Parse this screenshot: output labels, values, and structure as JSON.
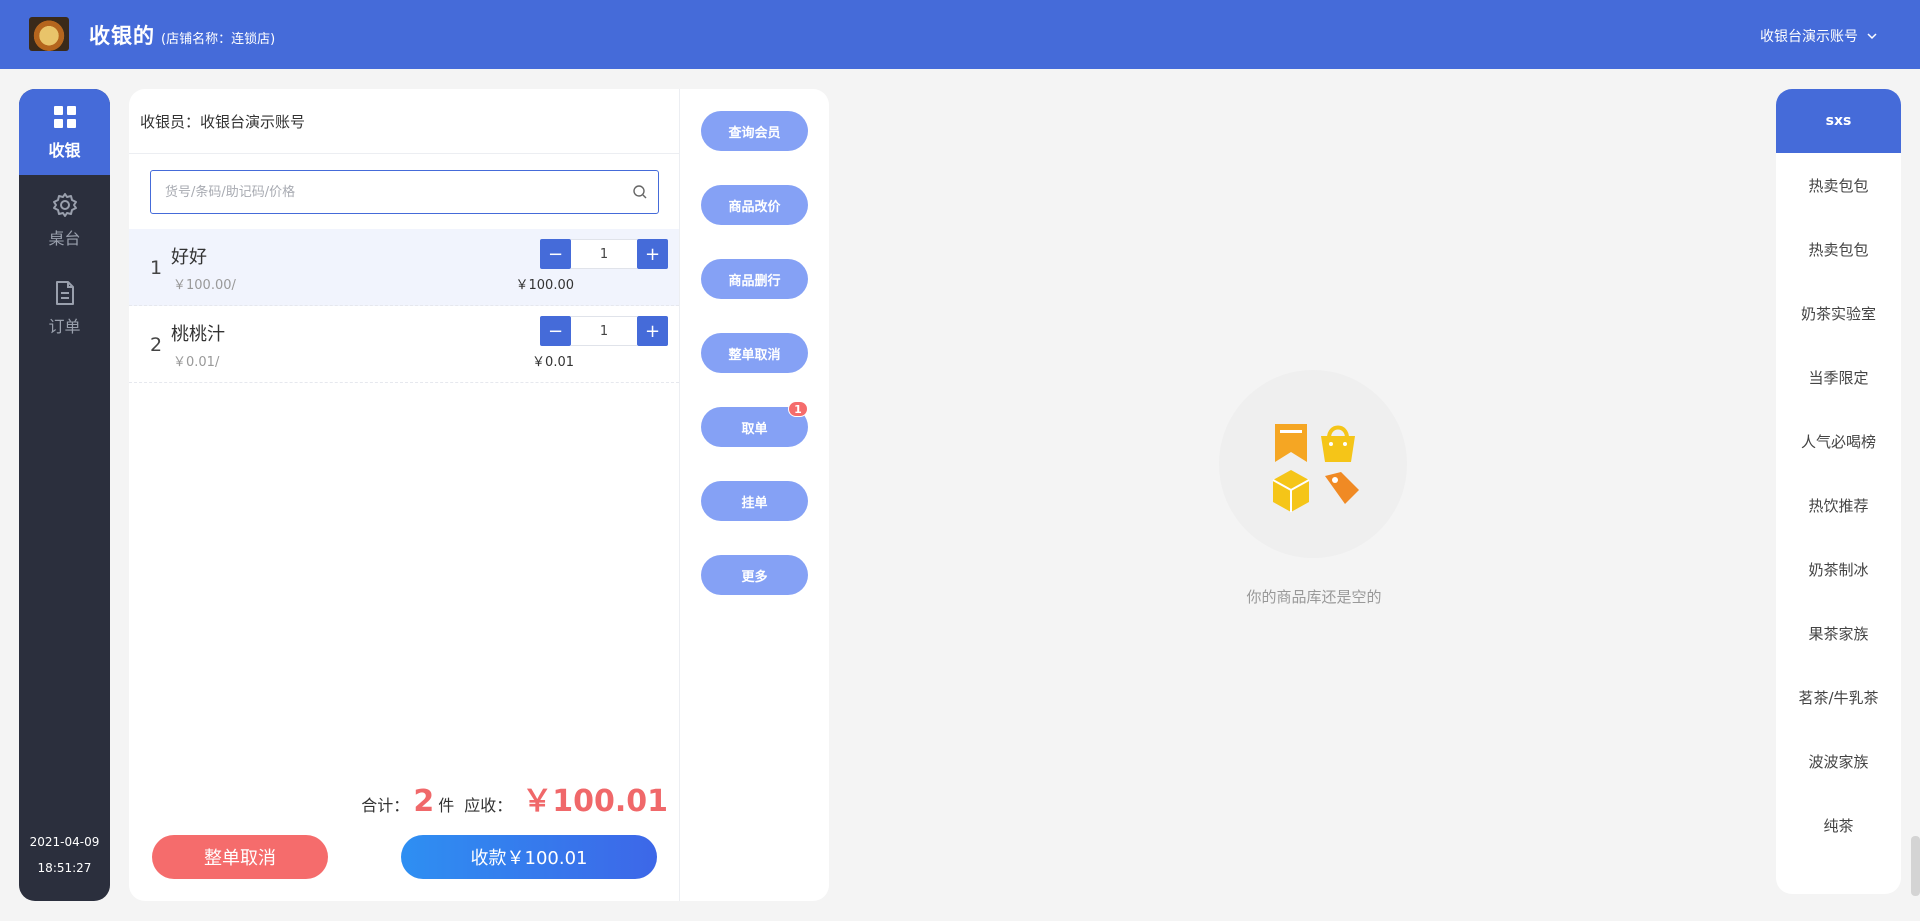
{
  "header": {
    "title": "收银的",
    "store_name": "(店铺名称：连锁店)",
    "account": "收银台演示账号"
  },
  "nav": {
    "items": [
      {
        "label": "收银",
        "icon": "grid-icon",
        "active": true
      },
      {
        "label": "桌台",
        "icon": "gear-icon",
        "active": false
      },
      {
        "label": "订单",
        "icon": "document-icon",
        "active": false
      }
    ],
    "date": "2021-04-09",
    "time": "18:51:27"
  },
  "order": {
    "cashier_line": "收银员：收银台演示账号",
    "search_placeholder": "货号/条码/助记码/价格",
    "items": [
      {
        "index": "1",
        "name": "好好",
        "unit_price": "￥100.00/",
        "quantity": "1",
        "subtotal": "￥100.00"
      },
      {
        "index": "2",
        "name": "桃桃汁",
        "unit_price": "￥0.01/",
        "quantity": "1",
        "subtotal": "￥0.01"
      }
    ],
    "total_label": "合计：",
    "total_count": "2",
    "count_unit": "件",
    "due_label": "应收：",
    "due_amount": "￥100.01",
    "cancel_all_label": "整单取消",
    "checkout_label": "收款￥100.01"
  },
  "actions": [
    {
      "label": "查询会员"
    },
    {
      "label": "商品改价"
    },
    {
      "label": "商品删行"
    },
    {
      "label": "整单取消"
    },
    {
      "label": "取单",
      "badge": "1"
    },
    {
      "label": "挂单"
    },
    {
      "label": "更多"
    }
  ],
  "empty_state": {
    "text": "你的商品库还是空的"
  },
  "categories": {
    "active": "sxs",
    "items": [
      "热卖包包",
      "热卖包包",
      "奶茶实验室",
      "当季限定",
      "人气必喝榜",
      "热饮推荐",
      "奶茶制冰",
      "果茶家族",
      "茗茶/牛乳茶",
      "波波家族",
      "纯茶"
    ]
  },
  "colors": {
    "primary": "#456bd9",
    "danger": "#f56c6c",
    "action": "#85a1f5",
    "nav_bg": "#2b2f3d"
  }
}
